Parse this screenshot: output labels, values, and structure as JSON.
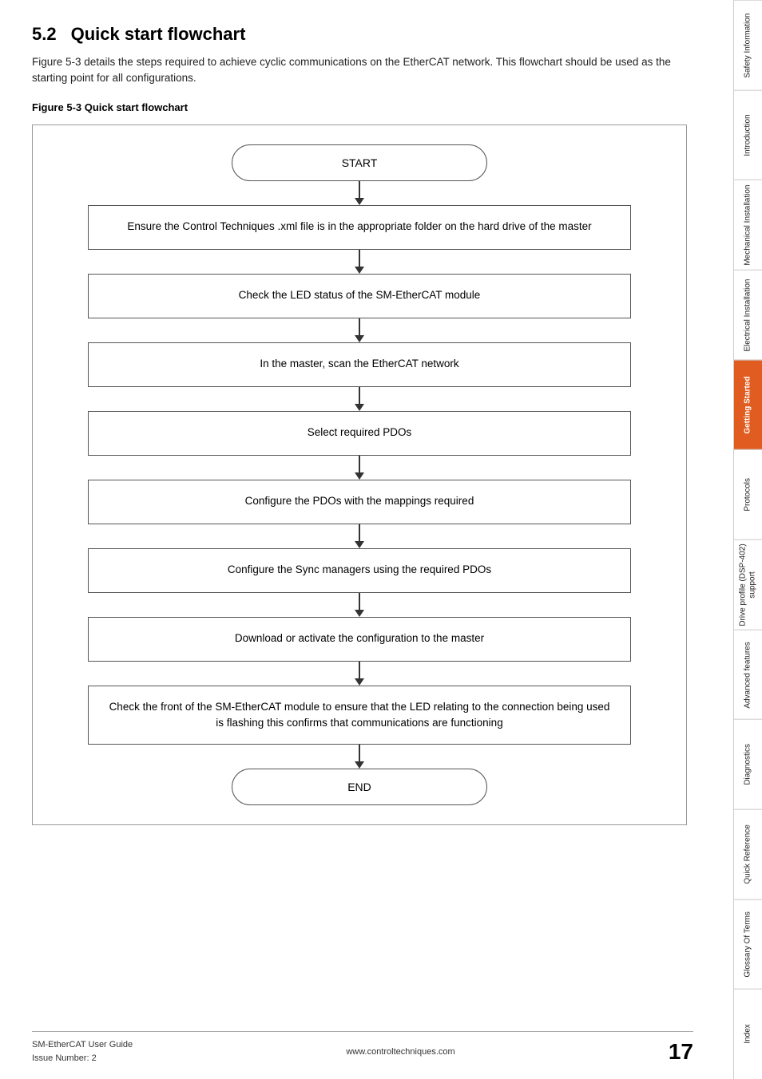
{
  "section": {
    "number": "5.2",
    "heading": "Quick start flowchart",
    "intro": "Figure 5-3 details the steps required to achieve cyclic communications on the EtherCAT network. This flowchart should be used as the starting point for all configurations.",
    "figure_caption": "Figure 5-3  Quick start flowchart"
  },
  "flowchart": {
    "nodes": [
      {
        "id": "start",
        "type": "oval",
        "text": "START"
      },
      {
        "id": "step1",
        "type": "rect",
        "text": "Ensure the Control Techniques .xml file is in the appropriate folder on the hard drive of the master"
      },
      {
        "id": "step2",
        "type": "rect",
        "text": "Check the LED status of the SM-EtherCAT module"
      },
      {
        "id": "step3",
        "type": "rect",
        "text": "In the master, scan the EtherCAT network"
      },
      {
        "id": "step4",
        "type": "rect",
        "text": "Select required PDOs"
      },
      {
        "id": "step5",
        "type": "rect",
        "text": "Configure the PDOs with the mappings required"
      },
      {
        "id": "step6",
        "type": "rect",
        "text": "Configure the Sync managers using the required  PDOs"
      },
      {
        "id": "step7",
        "type": "rect",
        "text": "Download or activate the configuration to the master"
      },
      {
        "id": "step8",
        "type": "rect",
        "text": "Check the front of the SM-EtherCAT module to ensure that the LED relating to the connection being used is flashing this confirms that communications are functioning"
      },
      {
        "id": "end",
        "type": "oval",
        "text": "END"
      }
    ]
  },
  "sidebar": {
    "tabs": [
      {
        "id": "safety",
        "label": "Safety Information",
        "active": false
      },
      {
        "id": "intro",
        "label": "Introduction",
        "active": false
      },
      {
        "id": "mech",
        "label": "Mechanical Installation",
        "active": false
      },
      {
        "id": "elec",
        "label": "Electrical Installation",
        "active": false
      },
      {
        "id": "getting",
        "label": "Getting Started",
        "active": true
      },
      {
        "id": "protocols",
        "label": "Protocols",
        "active": false
      },
      {
        "id": "drive",
        "label": "Drive profile (DSP-402) support",
        "active": false
      },
      {
        "id": "advanced",
        "label": "Advanced features",
        "active": false
      },
      {
        "id": "diag",
        "label": "Diagnostics",
        "active": false
      },
      {
        "id": "quick",
        "label": "Quick Reference",
        "active": false
      },
      {
        "id": "glossary",
        "label": "Glossary Of Terms",
        "active": false
      },
      {
        "id": "index",
        "label": "Index",
        "active": false
      }
    ]
  },
  "footer": {
    "left_line1": "SM-EtherCAT User Guide",
    "left_line2": "Issue Number:  2",
    "center": "www.controltechniques.com",
    "page_number": "17"
  }
}
